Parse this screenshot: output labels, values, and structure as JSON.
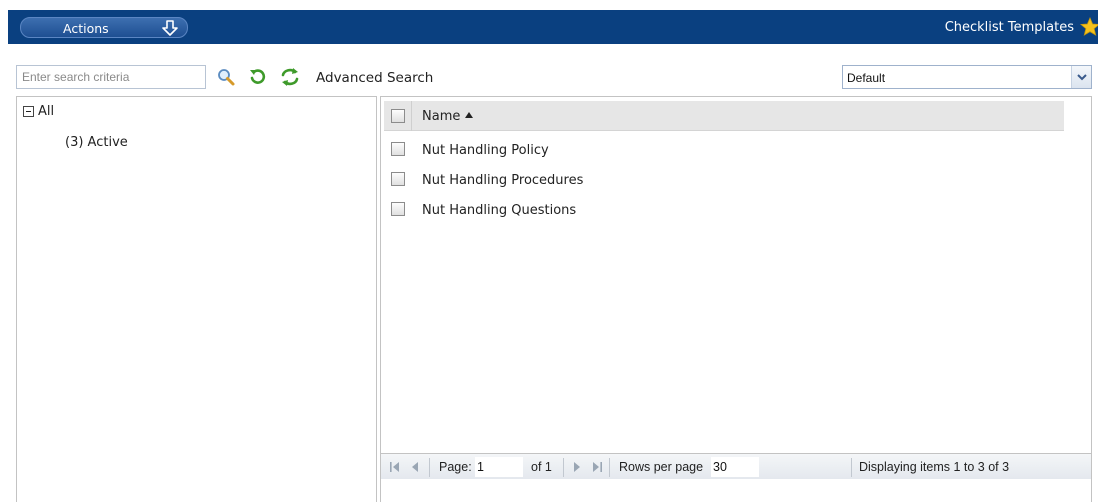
{
  "header": {
    "actions_label": "Actions",
    "title": "Checklist Templates"
  },
  "toolbar": {
    "search_placeholder": "Enter search criteria",
    "advanced_search_label": "Advanced Search",
    "view_select_value": "Default"
  },
  "tree": {
    "root_label": "All",
    "children": [
      {
        "label": "(3) Active"
      }
    ]
  },
  "grid": {
    "column_name": "Name",
    "rows": [
      {
        "name": "Nut Handling Policy"
      },
      {
        "name": "Nut Handling Procedures"
      },
      {
        "name": "Nut Handling Questions"
      }
    ]
  },
  "pager": {
    "page_label": "Page:",
    "page_value": "1",
    "of_label": "of 1",
    "rows_per_page_label": "Rows per page",
    "rows_per_page_value": "30",
    "display_text": "Displaying items 1 to 3 of 3"
  },
  "colors": {
    "header_bg": "#0a4080",
    "button_bg": "#2a5ca0",
    "grid_header_bg": "#e6e6e6",
    "star": "#f6c21c"
  }
}
